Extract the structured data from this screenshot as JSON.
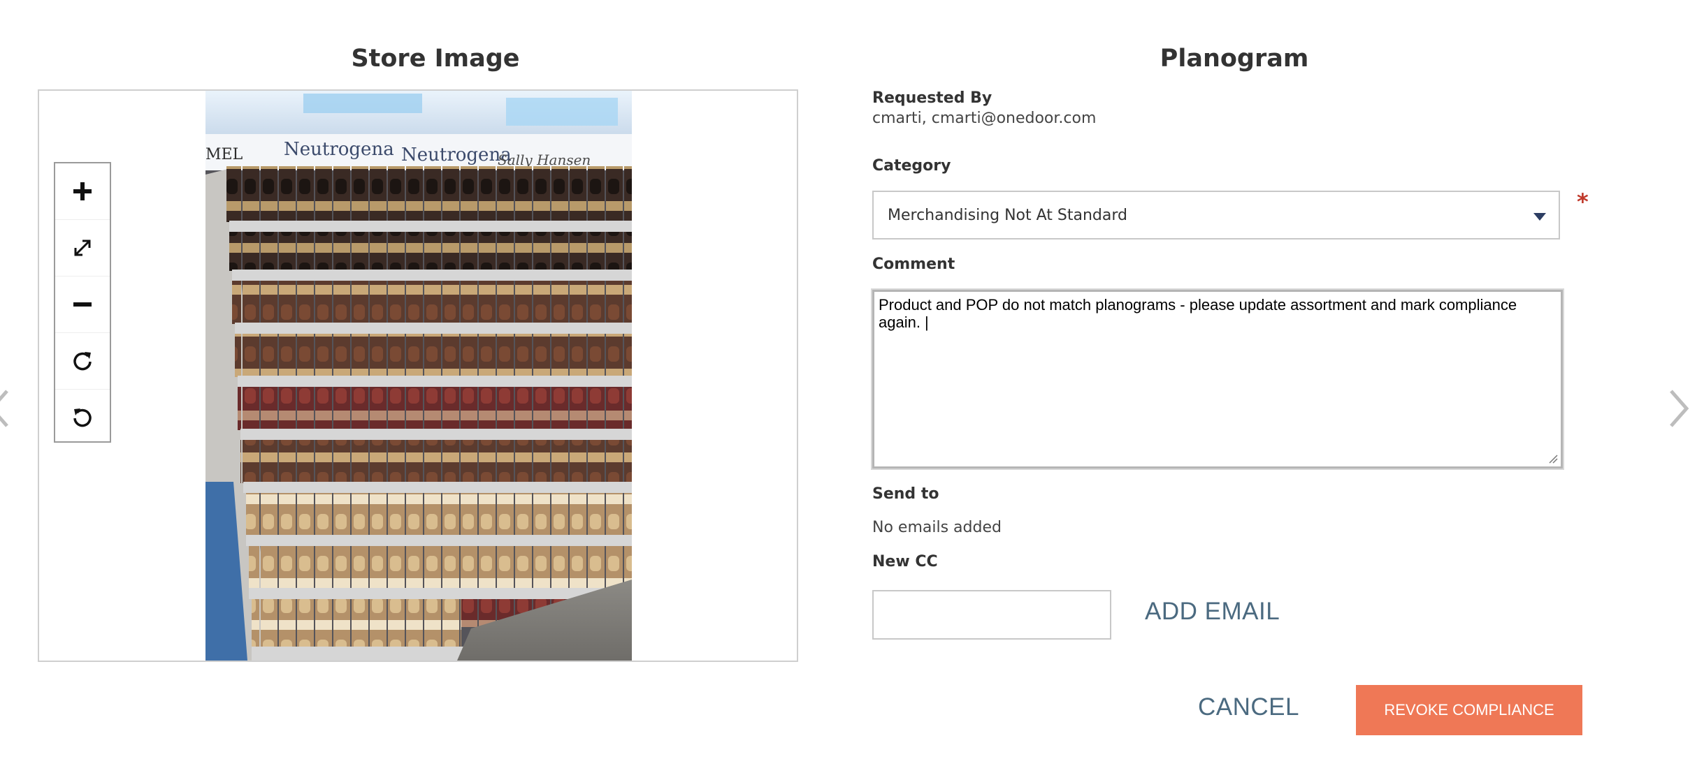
{
  "store_panel": {
    "title": "Store Image",
    "photo_signage": [
      "Neutrogena",
      "Neutrogena",
      "Sally Hansen",
      "MEL"
    ],
    "zoom_tools": [
      "zoom-in-icon",
      "fullscreen-icon",
      "zoom-out-icon",
      "rotate-right-icon",
      "rotate-left-icon"
    ]
  },
  "planogram_panel": {
    "title": "Planogram",
    "requested_by_label": "Requested By",
    "requested_by_value": "cmarti, cmarti@onedoor.com",
    "category_label": "Category",
    "category_value": "Merchandising Not At Standard",
    "required_mark": "*",
    "comment_label": "Comment",
    "comment_value": "Product and POP do not match planograms - please update assortment and mark compliance again. |",
    "send_to_label": "Send to",
    "send_to_value": "No emails added",
    "new_cc_label": "New CC",
    "new_cc_value": "",
    "add_email_label": "ADD EMAIL"
  },
  "actions": {
    "cancel_label": "CANCEL",
    "revoke_label": "REVOKE COMPLIANCE"
  },
  "colors": {
    "accent": "#ef7856",
    "link": "#4b6a80",
    "required": "#c0392b"
  }
}
